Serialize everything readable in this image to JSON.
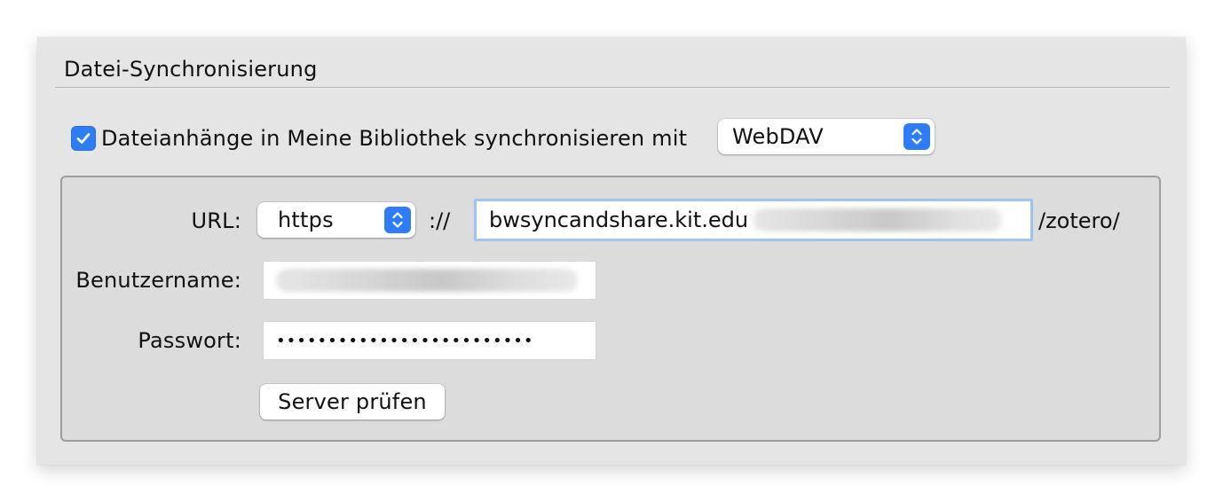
{
  "section": {
    "title": "Datei-Synchronisierung"
  },
  "sync": {
    "checked": true,
    "label": "Dateianhänge in Meine Bibliothek synchronisieren mit",
    "method_selected": "WebDAV"
  },
  "webdav": {
    "url_label": "URL:",
    "scheme_selected": "https",
    "scheme_separator": "://",
    "url_value": "bwsyncandshare.kit.edu",
    "url_suffix": "/zotero/",
    "username_label": "Benutzername:",
    "password_label": "Passwort:",
    "password_masked": "•••••••••••••••••••••••••",
    "verify_button": "Server prüfen"
  },
  "icons": {
    "checkbox": "checkmark-icon",
    "popup_arrows": "updown-chevron-icon"
  },
  "colors": {
    "accent": "#2f7df6",
    "window_bg": "#e5e5e5",
    "focus_ring": "#9ec2f4"
  }
}
